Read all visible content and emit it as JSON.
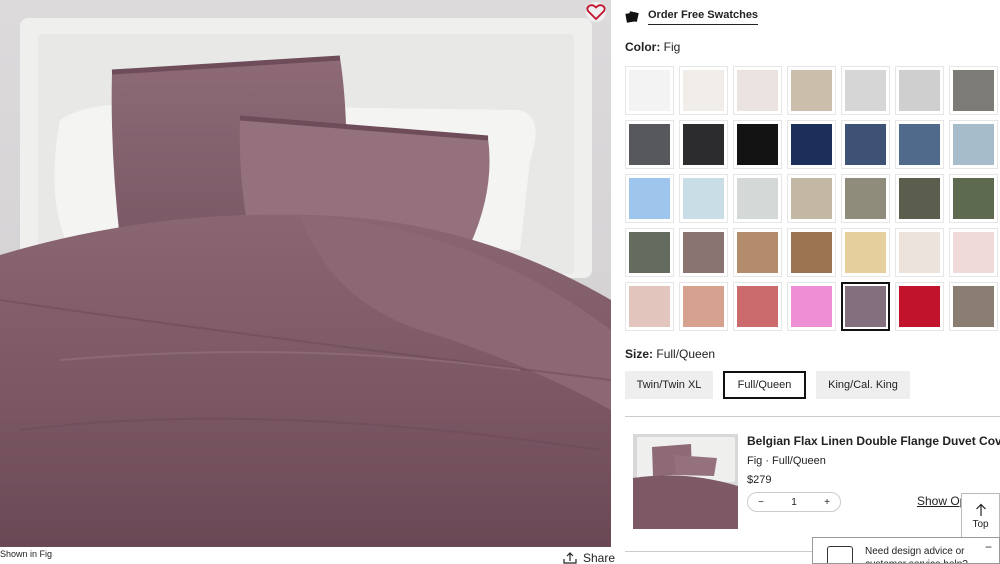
{
  "hero": {
    "caption": "Shown in Fig",
    "share_label": "Share"
  },
  "swatches_link": {
    "label": "Order Free Swatches"
  },
  "color": {
    "label": "Color:",
    "selected": "Fig",
    "options": [
      "#f3f3f3",
      "#f1eee9",
      "#ebe3df",
      "#cbbfac",
      "#d6d6d6",
      "#cfcfd0",
      "#7c7b76",
      "#57585c",
      "#2c2c2e",
      "#131314",
      "#1c2f5a",
      "#3e5275",
      "#4f6a8b",
      "#a7bccb",
      "#9ec6ec",
      "#c9dde7",
      "#d4d9d7",
      "#c3b8a3",
      "#8f8c7b",
      "#5c5e4d",
      "#5d6a4f",
      "#636c5e",
      "#8a7472",
      "#b38d6b",
      "#9b7350",
      "#e5cf9c",
      "#ece3dc",
      "#efd9d9",
      "#e2c6bd",
      "#d6a18f",
      "#cc6b6d",
      "#ee8fd6",
      "#846f7e",
      "#c1132c",
      "#8a7e72"
    ],
    "selected_index": 32
  },
  "size": {
    "label": "Size:",
    "selected": "Full/Queen",
    "options": [
      "Twin/Twin XL",
      "Full/Queen",
      "King/Cal. King"
    ],
    "selected_index": 1
  },
  "cart_item": {
    "name": "Belgian Flax Linen Double Flange Duvet Cover",
    "variant": "Fig · Full/Queen",
    "price": "$279",
    "qty_minus": "−",
    "qty": "1",
    "qty_plus": "+",
    "show_options": "Show Op"
  },
  "top_button": {
    "label": "Top"
  },
  "help": {
    "text": "Need design advice or customer service help?",
    "close": "−"
  }
}
